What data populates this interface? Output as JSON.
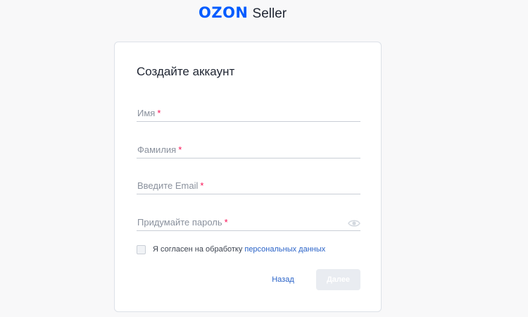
{
  "brand": {
    "logo": "OZON",
    "product": "Seller",
    "color": "#005bff"
  },
  "form": {
    "title": "Создайте аккаунт",
    "required_mark": "*",
    "fields": [
      {
        "label": "Имя"
      },
      {
        "label": "Фамилия"
      },
      {
        "label": "Введите Email"
      },
      {
        "label": "Придумайте пароль",
        "icon": "eye-icon"
      }
    ],
    "consent": {
      "text": "Я согласен на обработку",
      "link": "персональных данных",
      "checked": false
    },
    "buttons": {
      "back": "Назад",
      "next": "Далее"
    }
  },
  "colors": {
    "accent": "#005bff",
    "link": "#2a63c8",
    "required": "#f91155",
    "disabled_button": "#e9ecf1"
  }
}
